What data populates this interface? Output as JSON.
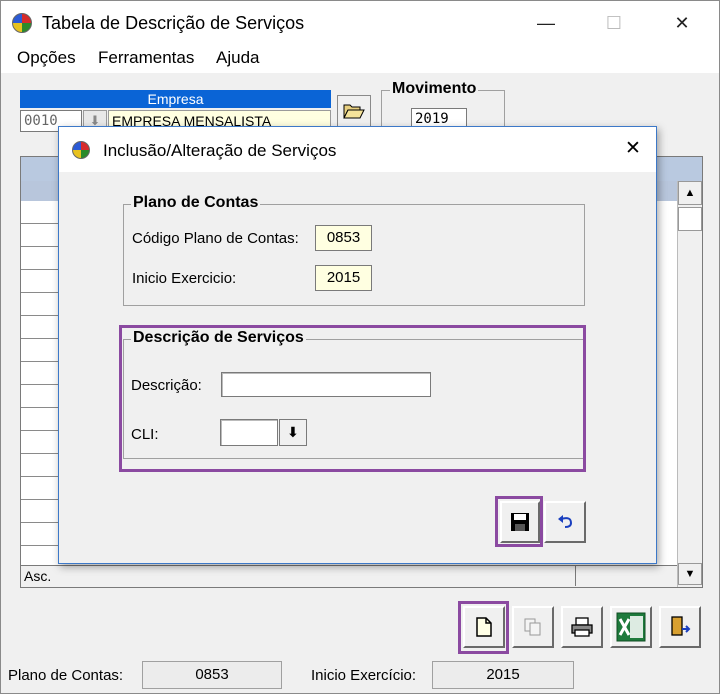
{
  "window": {
    "title": "Tabela de Descrição de Serviços",
    "minimize": "—",
    "maximize": "☐",
    "close": "✕"
  },
  "menu": {
    "items": [
      "Opções",
      "Ferramentas",
      "Ajuda"
    ]
  },
  "empresa": {
    "header": "Empresa",
    "code": "0010",
    "name": "EMPRESA MENSALISTA"
  },
  "movimento": {
    "label": "Movimento",
    "year": "2019"
  },
  "grid": {
    "footer_label": "Asc."
  },
  "dialog": {
    "title": "Inclusão/Alteração de Serviços",
    "close": "✕",
    "plano_contas": {
      "group_title": "Plano de Contas",
      "codigo_label": "Código Plano de Contas:",
      "codigo_value": "0853",
      "inicio_label": "Inicio Exercicio:",
      "inicio_value": "2015"
    },
    "descricao": {
      "group_title": "Descrição de Serviços",
      "descricao_label": "Descrição:",
      "descricao_value": "",
      "cli_label": "CLI:",
      "cli_value": ""
    }
  },
  "status": {
    "plano_label": "Plano de Contas:",
    "plano_value": "0853",
    "inicio_label": "Inicio Exercício:",
    "inicio_value": "2015"
  },
  "colors": {
    "highlight": "#8b4aa1",
    "empresa_header": "#0a64d6",
    "excel_green": "#1e7a3c"
  }
}
